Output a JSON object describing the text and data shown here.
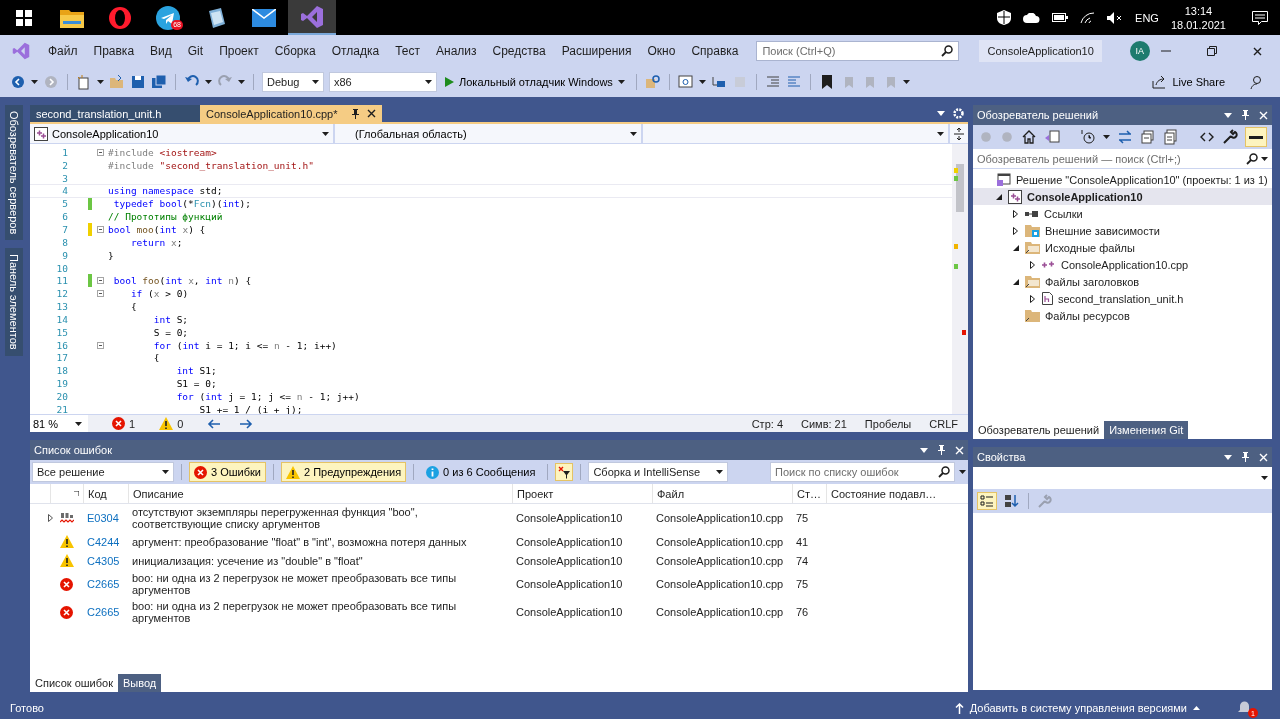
{
  "taskbar": {
    "apps": [
      {
        "kind": "folder",
        "active": false
      },
      {
        "kind": "opera",
        "active": false
      },
      {
        "kind": "telegram",
        "active": false,
        "badge": "68"
      },
      {
        "kind": "notes",
        "active": false
      },
      {
        "kind": "mail",
        "active": false
      },
      {
        "kind": "vs",
        "active": true
      }
    ],
    "language": "ENG",
    "time": "13:14",
    "date": "18.01.2021"
  },
  "menu": {
    "items": [
      "Файл",
      "Правка",
      "Вид",
      "Git",
      "Проект",
      "Сборка",
      "Отладка",
      "Тест",
      "Анализ",
      "Средства",
      "Расширения",
      "Окно",
      "Справка"
    ],
    "search": {
      "placeholder": "Поиск (Ctrl+Q)"
    },
    "solution_name": "ConsoleApplication10",
    "avatar": "IA"
  },
  "toolbar": {
    "configuration": "Debug",
    "platform": "x86",
    "run": "Локальный отладчик Windows",
    "live_share": "Live Share"
  },
  "side_tabs": [
    "Обозреватель серверов",
    "Панель элементов"
  ],
  "editor": {
    "tabs": [
      {
        "label": "second_translation_unit.h",
        "selected": false
      },
      {
        "label": "ConsoleApplication10.cpp*",
        "selected": true
      }
    ],
    "nav": [
      "ConsoleApplication10",
      "(Глобальная область)"
    ],
    "lines": [
      {
        "number": "1",
        "changed": false,
        "foldable": true,
        "tokens": [
          {
            "kind": "preproc",
            "text": "#include "
          },
          {
            "kind": "string",
            "text": "<iostream>"
          }
        ]
      },
      {
        "number": "2",
        "changed": false,
        "foldable": false,
        "tokens": [
          {
            "kind": "preproc",
            "text": "#include "
          },
          {
            "kind": "string",
            "text": "\"second_translation_unit.h\""
          }
        ]
      },
      {
        "number": "3",
        "changed": false,
        "foldable": false
      },
      {
        "number": "4",
        "changed": false,
        "foldable": false,
        "current": true,
        "tokens": [
          {
            "kind": "keyword",
            "text": "using namespace"
          },
          {
            "kind": "plain",
            "text": " std;"
          }
        ]
      },
      {
        "number": "5",
        "changed": true,
        "saved": true,
        "foldable": false,
        "tokens": [
          {
            "kind": "keyword",
            "text": " typedef bool"
          },
          {
            "kind": "plain",
            "text": "(*"
          },
          {
            "kind": "type",
            "text": "Fcn"
          },
          {
            "kind": "plain",
            "text": ")("
          },
          {
            "kind": "keyword",
            "text": "int"
          },
          {
            "kind": "plain",
            "text": ");"
          }
        ]
      },
      {
        "number": "6",
        "changed": false,
        "foldable": false,
        "tokens": [
          {
            "kind": "comment",
            "text": "// Прототипы функций"
          }
        ]
      },
      {
        "number": "7",
        "changed": true,
        "saved": false,
        "foldable": true,
        "tokens": [
          {
            "kind": "keyword",
            "text": "bool"
          },
          {
            "kind": "function",
            "text": " moo"
          },
          {
            "kind": "plain",
            "text": "("
          },
          {
            "kind": "keyword",
            "text": "int"
          },
          {
            "kind": "param",
            "text": " x"
          },
          {
            "kind": "plain",
            "text": ") {"
          }
        ]
      },
      {
        "number": "8",
        "changed": false,
        "foldable": false,
        "tokens": [
          {
            "kind": "keyword",
            "text": "    return"
          },
          {
            "kind": "param",
            "text": " x"
          },
          {
            "kind": "plain",
            "text": ";"
          }
        ]
      },
      {
        "number": "9",
        "changed": false,
        "foldable": false,
        "tokens": [
          {
            "kind": "plain",
            "text": "}"
          }
        ]
      },
      {
        "number": "10",
        "changed": false,
        "foldable": false
      },
      {
        "number": "11",
        "changed": true,
        "saved": true,
        "foldable": true,
        "tokens": [
          {
            "kind": "keyword",
            "text": " bool"
          },
          {
            "kind": "function",
            "text": " foo"
          },
          {
            "kind": "plain",
            "text": "("
          },
          {
            "kind": "keyword",
            "text": "int"
          },
          {
            "kind": "param",
            "text": " x"
          },
          {
            "kind": "plain",
            "text": ", "
          },
          {
            "kind": "keyword",
            "text": "int"
          },
          {
            "kind": "param",
            "text": " n"
          },
          {
            "kind": "plain",
            "text": ") {"
          }
        ]
      },
      {
        "number": "12",
        "changed": false,
        "foldable": true,
        "tokens": [
          {
            "kind": "keyword",
            "text": "    if"
          },
          {
            "kind": "plain",
            "text": " ("
          },
          {
            "kind": "param",
            "text": "x"
          },
          {
            "kind": "plain",
            "text": " > 0)"
          }
        ]
      },
      {
        "number": "13",
        "changed": false,
        "foldable": false,
        "tokens": [
          {
            "kind": "plain",
            "text": "    {"
          }
        ]
      },
      {
        "number": "14",
        "changed": false,
        "foldable": false,
        "tokens": [
          {
            "kind": "keyword",
            "text": "        int"
          },
          {
            "kind": "plain",
            "text": " S;"
          }
        ]
      },
      {
        "number": "15",
        "changed": false,
        "foldable": false,
        "tokens": [
          {
            "kind": "plain",
            "text": "        S = 0;"
          }
        ]
      },
      {
        "number": "16",
        "changed": false,
        "foldable": true,
        "tokens": [
          {
            "kind": "keyword",
            "text": "        for"
          },
          {
            "kind": "plain",
            "text": " ("
          },
          {
            "kind": "keyword",
            "text": "int"
          },
          {
            "kind": "plain",
            "text": " i = 1; i <= "
          },
          {
            "kind": "param",
            "text": "n"
          },
          {
            "kind": "plain",
            "text": " - 1; i++)"
          }
        ]
      },
      {
        "number": "17",
        "changed": false,
        "foldable": false,
        "tokens": [
          {
            "kind": "plain",
            "text": "        {"
          }
        ]
      },
      {
        "number": "18",
        "changed": false,
        "foldable": false,
        "tokens": [
          {
            "kind": "keyword",
            "text": "            int"
          },
          {
            "kind": "plain",
            "text": " S1;"
          }
        ]
      },
      {
        "number": "19",
        "changed": false,
        "foldable": false,
        "tokens": [
          {
            "kind": "plain",
            "text": "            S1 = 0;"
          }
        ]
      },
      {
        "number": "20",
        "changed": false,
        "foldable": false,
        "tokens": [
          {
            "kind": "keyword",
            "text": "            for"
          },
          {
            "kind": "plain",
            "text": " ("
          },
          {
            "kind": "keyword",
            "text": "int"
          },
          {
            "kind": "plain",
            "text": " j = 1; j <= "
          },
          {
            "kind": "param",
            "text": "n"
          },
          {
            "kind": "plain",
            "text": " - 1; j++)"
          }
        ]
      },
      {
        "number": "21",
        "changed": false,
        "foldable": false,
        "tokens": [
          {
            "kind": "plain",
            "text": "                S1 += 1 / (i + j);"
          }
        ]
      }
    ],
    "status": {
      "zoom": "81 %",
      "errors": "1",
      "warnings": "0",
      "line": "Стр: 4",
      "column": "Симв: 21",
      "whitespace": "Пробелы",
      "line_ending": "CRLF"
    }
  },
  "error_list": {
    "title": "Список ошибок",
    "scope": "Все решение",
    "filters": [
      {
        "kind": "error",
        "label": "3 Ошибки",
        "selected": true
      },
      {
        "kind": "warning",
        "label": "2 Предупреждения",
        "selected": true
      },
      {
        "kind": "info",
        "label": "0 из 6 Сообщения",
        "selected": false
      }
    ],
    "source": "Сборка и IntelliSense",
    "search": {
      "placeholder": "Поиск по списку ошибок"
    },
    "columns": [
      "Код",
      "Описание",
      "Проект",
      "Файл",
      "Ст…",
      "Состояние подавл…"
    ],
    "rows": [
      {
        "kind": "intellisense",
        "expandable": true,
        "code": "E0304",
        "description": "отсутствуют экземпляры перегруженная функция \"boo\", соответствующие списку аргументов",
        "project": "ConsoleApplication10",
        "file": "ConsoleApplication10.cpp",
        "line": "75"
      },
      {
        "kind": "warning",
        "expandable": false,
        "code": "C4244",
        "description": "аргумент: преобразование \"float\" в \"int\", возможна потеря данных",
        "project": "ConsoleApplication10",
        "file": "ConsoleApplication10.cpp",
        "line": "41"
      },
      {
        "kind": "warning",
        "expandable": false,
        "code": "C4305",
        "description": "инициализация: усечение из \"double\" в \"float\"",
        "project": "ConsoleApplication10",
        "file": "ConsoleApplication10.cpp",
        "line": "74"
      },
      {
        "kind": "error",
        "expandable": false,
        "code": "C2665",
        "description": "boo: ни одна из 2 перегрузок не может преобразовать все типы аргументов",
        "project": "ConsoleApplication10",
        "file": "ConsoleApplication10.cpp",
        "line": "75"
      },
      {
        "kind": "error",
        "expandable": false,
        "code": "C2665",
        "description": "boo: ни одна из 2 перегрузок не может преобразовать все типы аргументов",
        "project": "ConsoleApplication10",
        "file": "ConsoleApplication10.cpp",
        "line": "76"
      }
    ],
    "tabs": [
      {
        "label": "Список ошибок",
        "selected": true
      },
      {
        "label": "Вывод",
        "selected": false
      }
    ]
  },
  "solution_explorer": {
    "title": "Обозреватель решений",
    "search": {
      "placeholder": "Обозреватель решений — поиск (Ctrl+;)"
    },
    "tree": [
      {
        "kind": "solution",
        "label": "Решение \"ConsoleApplication10\" (проекты: 1 из 1)",
        "expandable": false,
        "selected": false,
        "children": [
          {
            "kind": "project",
            "label": "ConsoleApplication10",
            "expandable": true,
            "expanded": true,
            "selected": true,
            "children": [
              {
                "kind": "references",
                "label": "Ссылки",
                "expandable": true,
                "expanded": false,
                "selected": false
              },
              {
                "kind": "external",
                "label": "Внешние зависимости",
                "expandable": true,
                "expanded": false,
                "selected": false
              },
              {
                "kind": "filter",
                "label": "Исходные файлы",
                "expandable": true,
                "expanded": true,
                "selected": false,
                "children": [
                  {
                    "kind": "cpp",
                    "label": "ConsoleApplication10.cpp",
                    "expandable": true,
                    "expanded": false,
                    "selected": false
                  }
                ]
              },
              {
                "kind": "filter",
                "label": "Файлы заголовков",
                "expandable": true,
                "expanded": true,
                "selected": false,
                "children": [
                  {
                    "kind": "header",
                    "label": "second_translation_unit.h",
                    "expandable": true,
                    "expanded": false,
                    "selected": false
                  }
                ]
              },
              {
                "kind": "folder",
                "label": "Файлы ресурсов",
                "expandable": false,
                "selected": false
              }
            ]
          }
        ]
      }
    ],
    "tabs": [
      {
        "label": "Обозреватель решений",
        "selected": true
      },
      {
        "label": "Изменения Git",
        "selected": false
      }
    ]
  },
  "properties": {
    "title": "Свойства"
  },
  "status_bar": {
    "text": "Готово",
    "source_control": "Добавить в систему управления версиями",
    "notifications": "1"
  }
}
